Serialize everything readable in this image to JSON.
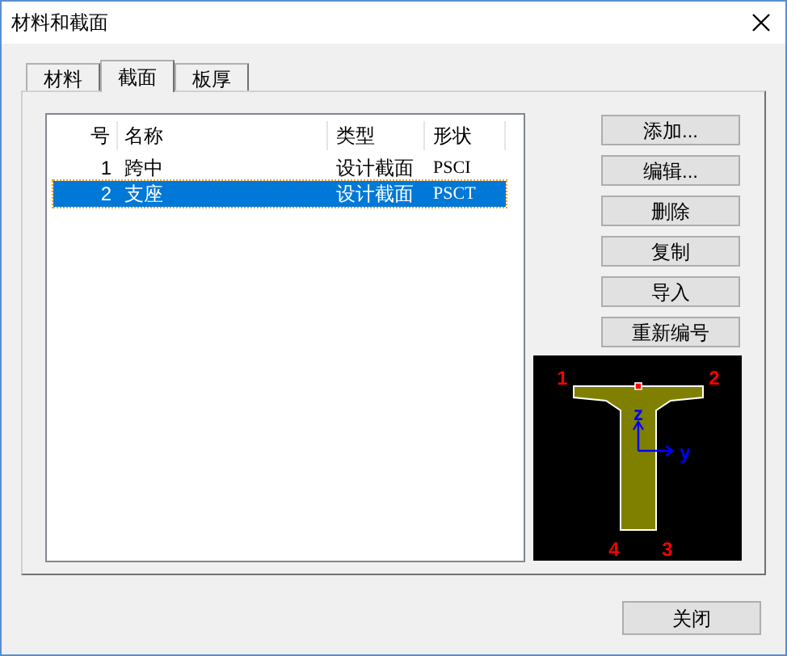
{
  "window": {
    "title": "材料和截面"
  },
  "tabs": [
    {
      "label": "材料",
      "selected": false
    },
    {
      "label": "截面",
      "selected": true
    },
    {
      "label": "板厚",
      "selected": false
    }
  ],
  "table": {
    "columns": [
      "号",
      "名称",
      "类型",
      "形状"
    ],
    "rows": [
      {
        "cells": [
          "1",
          "跨中",
          "设计截面",
          "PSCI"
        ],
        "selected": false
      },
      {
        "cells": [
          "2",
          "支座",
          "设计截面",
          "PSCT"
        ],
        "selected": true
      }
    ]
  },
  "buttons": [
    "添加...",
    "编辑...",
    "删除",
    "复制",
    "导入",
    "重新编号"
  ],
  "section_preview": {
    "point_labels": [
      "1",
      "2",
      "3",
      "4"
    ],
    "axis_labels": [
      "z",
      "y"
    ]
  },
  "close_button": "关闭"
}
